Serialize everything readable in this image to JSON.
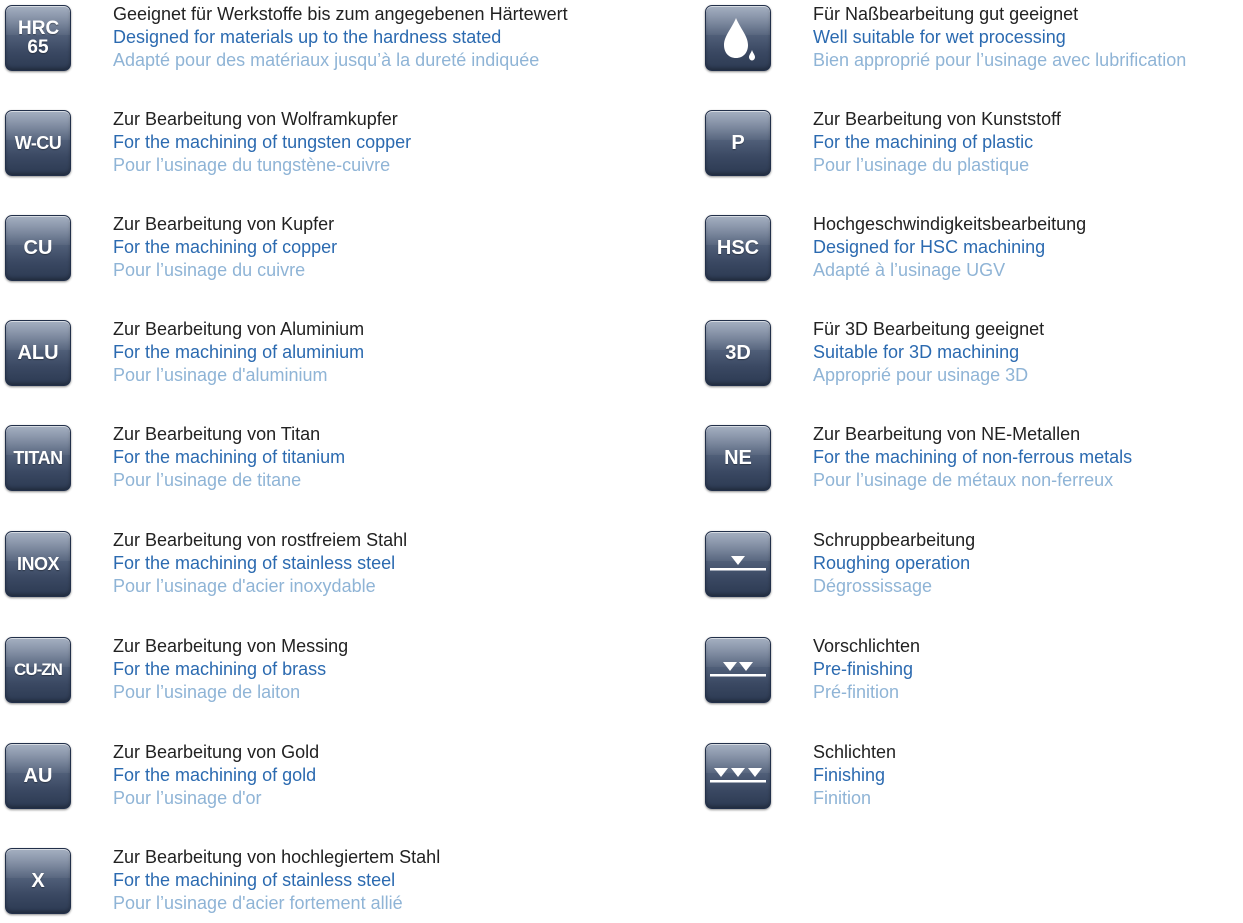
{
  "left_entries": [
    {
      "icon": "hrc-65-icon",
      "icon_text": "HRC 65",
      "de": "Geeignet für Werkstoffe bis zum angegebenen Härtewert",
      "en": "Designed for materials up to the hardness stated",
      "fr": "Adapté pour des matériaux jusqu’à la dureté indiquée"
    },
    {
      "icon": "w-cu-icon",
      "icon_text": "W-CU",
      "de": "Zur Bearbeitung von Wolframkupfer",
      "en": "For the machining of tungsten copper",
      "fr": "Pour l’usinage du tungstène-cuivre"
    },
    {
      "icon": "cu-icon",
      "icon_text": "CU",
      "de": "Zur Bearbeitung von Kupfer",
      "en": "For the machining of copper",
      "fr": "Pour l’usinage du cuivre"
    },
    {
      "icon": "alu-icon",
      "icon_text": "ALU",
      "de": "Zur Bearbeitung von Aluminium",
      "en": "For the machining of aluminium",
      "fr": "Pour l’usinage d'aluminium"
    },
    {
      "icon": "titan-icon",
      "icon_text": "TITAN",
      "de": "Zur Bearbeitung von Titan",
      "en": "For the machining of titanium",
      "fr": "Pour l’usinage de titane"
    },
    {
      "icon": "inox-icon",
      "icon_text": "INOX",
      "de": "Zur Bearbeitung von rostfreiem Stahl",
      "en": "For the machining of stainless steel",
      "fr": "Pour l’usinage d'acier inoxydable"
    },
    {
      "icon": "cu-zn-icon",
      "icon_text": "CU-ZN",
      "de": "Zur Bearbeitung von Messing",
      "en": "For the machining of brass",
      "fr": "Pour l’usinage de laiton"
    },
    {
      "icon": "au-icon",
      "icon_text": "AU",
      "de": "Zur Bearbeitung von Gold",
      "en": "For the machining of gold",
      "fr": "Pour l’usinage d'or"
    },
    {
      "icon": "x-icon",
      "icon_text": "X",
      "de": "Zur Bearbeitung von hochlegiertem Stahl",
      "en": "For the machining of stainless steel",
      "fr": "Pour l’usinage d'acier fortement allié"
    }
  ],
  "right_entries": [
    {
      "icon": "water-drop-icon",
      "icon_text": "",
      "de": "Für Naßbearbeitung gut geeignet",
      "en": "Well suitable for wet processing",
      "fr": "Bien approprié pour l’usinage avec lubrification"
    },
    {
      "icon": "p-icon",
      "icon_text": "P",
      "de": "Zur Bearbeitung von Kunststoff",
      "en": "For the machining of plastic",
      "fr": "Pour l’usinage du plastique"
    },
    {
      "icon": "hsc-icon",
      "icon_text": "HSC",
      "de": "Hochgeschwindigkeitsbearbeitung",
      "en": "Designed for HSC machining",
      "fr": "Adapté à l’usinage UGV"
    },
    {
      "icon": "3d-icon",
      "icon_text": "3D",
      "de": "Für 3D Bearbeitung geeignet",
      "en": "Suitable for 3D machining",
      "fr": "Approprié pour usinage 3D"
    },
    {
      "icon": "ne-icon",
      "icon_text": "NE",
      "de": "Zur Bearbeitung von NE-Metallen",
      "en": "For the machining of non-ferrous metals",
      "fr": "Pour l’usinage de métaux non-ferreux"
    },
    {
      "icon": "roughing-one-triangle-icon",
      "icon_text": "",
      "de": "Schruppbearbeitung",
      "en": "Roughing operation",
      "fr": "Dégrossissage"
    },
    {
      "icon": "pre-finishing-two-triangles-icon",
      "icon_text": "",
      "de": "Vorschlichten",
      "en": "Pre-finishing",
      "fr": "Pré-finition"
    },
    {
      "icon": "finishing-three-triangles-icon",
      "icon_text": "",
      "de": "Schlichten",
      "en": "Finishing",
      "fr": "Finition"
    }
  ],
  "colors": {
    "german_text": "#222222",
    "english_text": "#2b6ab0",
    "french_text": "#8fb4d6",
    "icon_dark": "#2c3a52",
    "icon_light": "#7e8da6"
  }
}
